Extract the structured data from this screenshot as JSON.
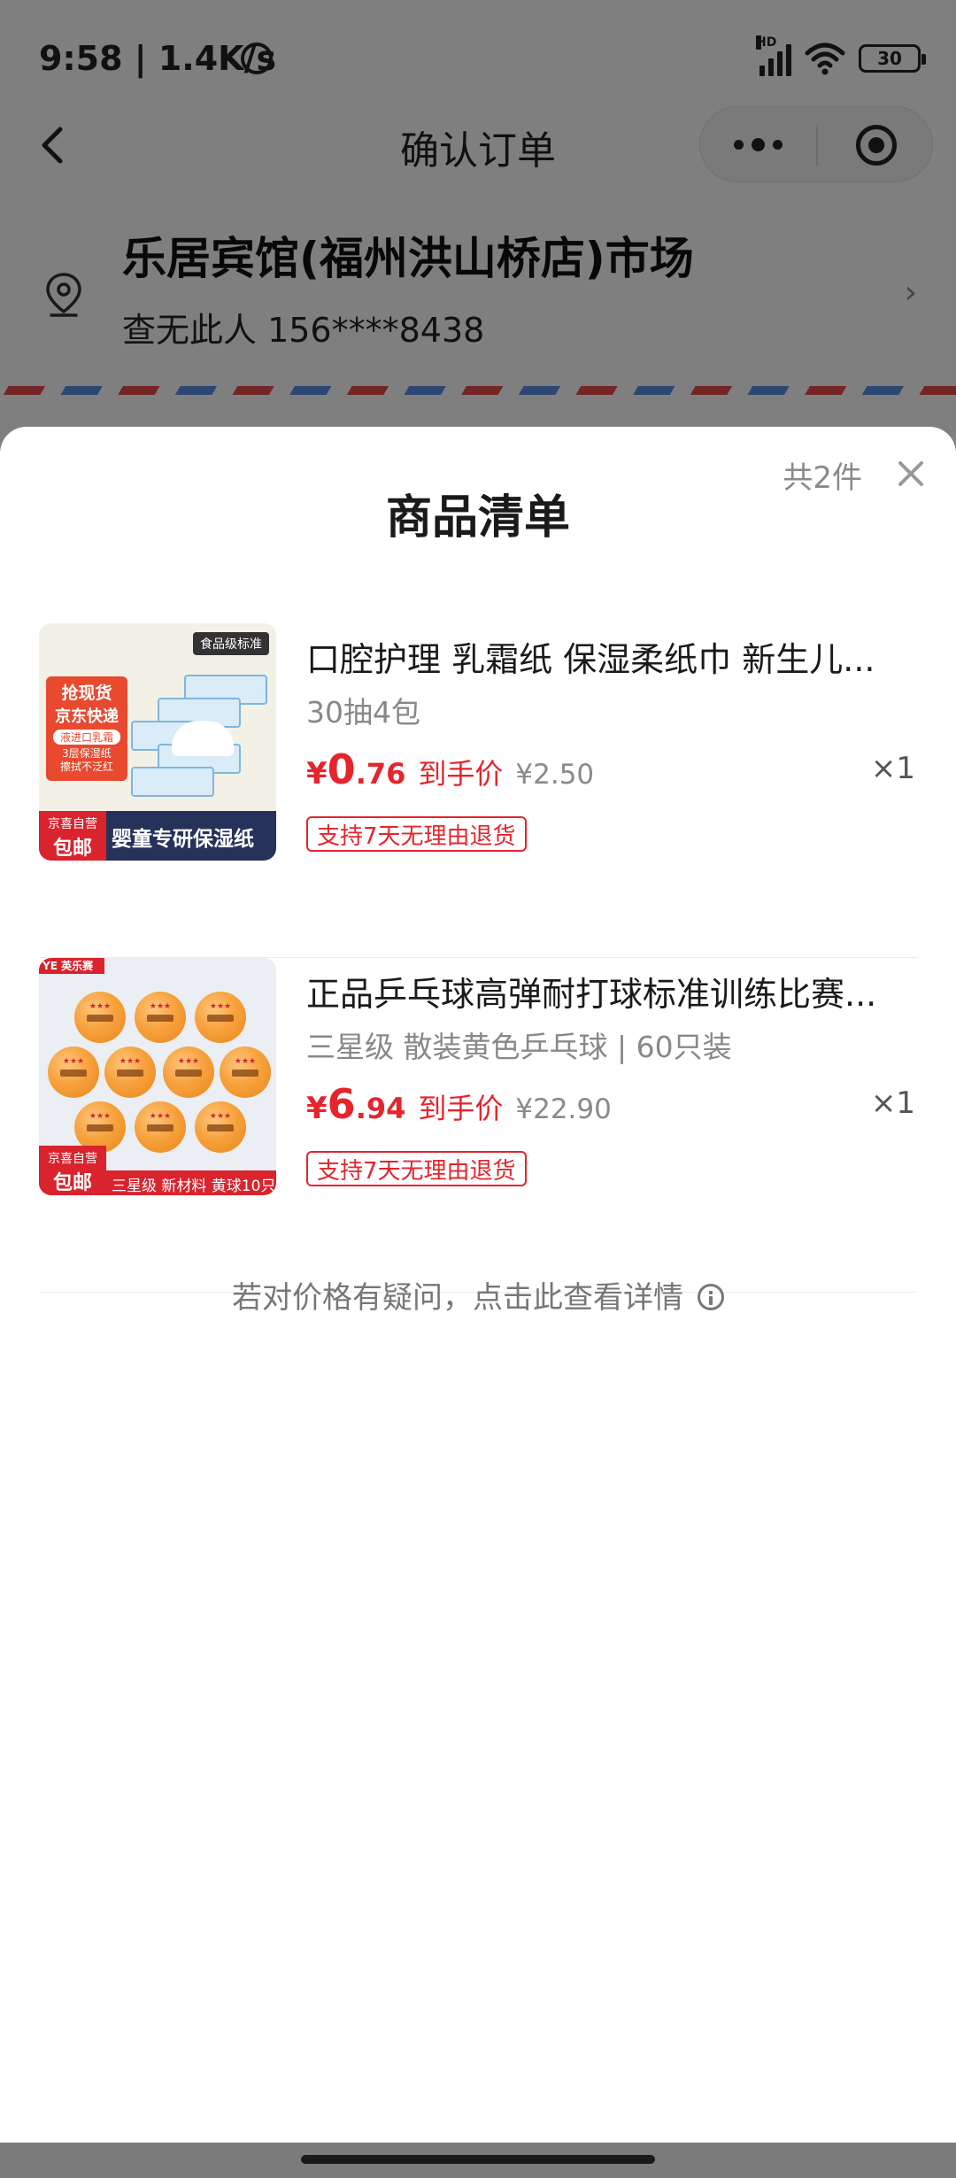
{
  "status_bar": {
    "time": "9:58 | 1.4K/s",
    "network_badge": "HD",
    "battery": "30"
  },
  "nav": {
    "title": "确认订单"
  },
  "address": {
    "name": "乐居宾馆(福州洪山桥店)市场",
    "contact": "查无此人 156****8438"
  },
  "sheet": {
    "title": "商品清单",
    "count": "共2件",
    "products": [
      {
        "name": "口腔护理 乳霜纸 保湿柔纸巾 新生儿...",
        "spec": "30抽4包",
        "price_symbol": "¥",
        "price_int": "0",
        "price_dec": ".76",
        "price_tag": "到手价",
        "original_price": "¥2.50",
        "qty": "×1",
        "badge": "支持7天无理由退货",
        "thumb": {
          "food_grade": "食品级标准",
          "promo_line1": "抢现货",
          "promo_line2": "京东快递",
          "promo_line3": "液进口乳霜",
          "promo_line4": "3层保湿纸",
          "promo_line5": "擦拭不泛红",
          "jd_top": "京喜自营",
          "jd_bottom": "包邮",
          "caption": "婴童专研保湿纸"
        }
      },
      {
        "name": "正品乒乓球高弹耐打球标准训练比赛...",
        "spec": "三星级 散装黄色乒乓球 | 60只装",
        "price_symbol": "¥",
        "price_int": "6",
        "price_dec": ".94",
        "price_tag": "到手价",
        "original_price": "¥22.90",
        "qty": "×1",
        "badge": "支持7天无理由退货",
        "thumb": {
          "brand": "YE 英乐赛",
          "jd_top": "京喜自营",
          "jd_bottom": "包邮",
          "caption": "三星级 新材料 黄球10只"
        }
      }
    ],
    "price_question": "若对价格有疑问，点击此查看详情"
  }
}
